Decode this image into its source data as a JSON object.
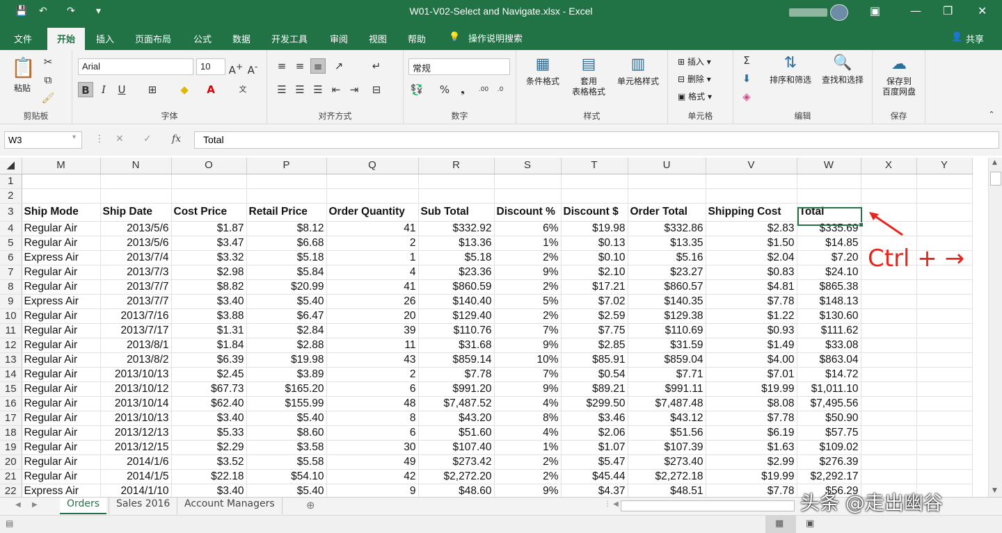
{
  "window": {
    "title": "W01-V02-Select and Navigate.xlsx  -  Excel"
  },
  "qat": {
    "save": "💾",
    "undo": "↶",
    "redo": "↷",
    "more": "▾"
  },
  "ribbon_tabs": [
    {
      "label": "文件"
    },
    {
      "label": "开始"
    },
    {
      "label": "插入"
    },
    {
      "label": "页面布局"
    },
    {
      "label": "公式"
    },
    {
      "label": "数据"
    },
    {
      "label": "开发工具"
    },
    {
      "label": "审阅"
    },
    {
      "label": "视图"
    },
    {
      "label": "帮助"
    }
  ],
  "tell_me": "操作说明搜索",
  "share": "共享",
  "ribbon": {
    "clipboard": {
      "paste": "粘贴",
      "label": "剪贴板"
    },
    "font": {
      "name": "Arial",
      "size": "10",
      "label": "字体",
      "bold": "B",
      "italic": "I",
      "underline": "U"
    },
    "alignment": {
      "label": "对齐方式"
    },
    "number": {
      "format": "常规",
      "label": "数字",
      "percent": "%",
      "comma": "❟"
    },
    "styles": {
      "conditional": "条件格式",
      "table_l1": "套用",
      "table_l2": "表格格式",
      "cell_styles": "单元格样式",
      "label": "样式"
    },
    "cells": {
      "insert": "插入",
      "delete": "删除",
      "format": "格式",
      "label": "单元格"
    },
    "editing": {
      "sort": "排序和筛选",
      "find": "查找和选择",
      "label": "编辑"
    },
    "save": {
      "l1": "保存到",
      "l2": "百度网盘",
      "label": "保存"
    }
  },
  "formula_bar": {
    "name_box": "W3",
    "fx": "fx",
    "value": "Total"
  },
  "columns": [
    "M",
    "N",
    "O",
    "P",
    "Q",
    "R",
    "S",
    "T",
    "U",
    "V",
    "W",
    "X",
    "Y"
  ],
  "headers": [
    "Ship Mode",
    "Ship Date",
    "Cost Price",
    "Retail Price",
    "Order Quantity",
    "Sub Total",
    "Discount %",
    "Discount $",
    "Order Total",
    "Shipping Cost",
    "Total"
  ],
  "rows": [
    {
      "n": "4",
      "c": [
        "Regular Air",
        "2013/5/6",
        "$1.87",
        "$8.12",
        "41",
        "$332.92",
        "6%",
        "$19.98",
        "$332.86",
        "$2.83",
        "$335.69"
      ]
    },
    {
      "n": "5",
      "c": [
        "Regular Air",
        "2013/5/6",
        "$3.47",
        "$6.68",
        "2",
        "$13.36",
        "1%",
        "$0.13",
        "$13.35",
        "$1.50",
        "$14.85"
      ]
    },
    {
      "n": "6",
      "c": [
        "Express Air",
        "2013/7/4",
        "$3.32",
        "$5.18",
        "1",
        "$5.18",
        "2%",
        "$0.10",
        "$5.16",
        "$2.04",
        "$7.20"
      ]
    },
    {
      "n": "7",
      "c": [
        "Regular Air",
        "2013/7/3",
        "$2.98",
        "$5.84",
        "4",
        "$23.36",
        "9%",
        "$2.10",
        "$23.27",
        "$0.83",
        "$24.10"
      ]
    },
    {
      "n": "8",
      "c": [
        "Regular Air",
        "2013/7/7",
        "$8.82",
        "$20.99",
        "41",
        "$860.59",
        "2%",
        "$17.21",
        "$860.57",
        "$4.81",
        "$865.38"
      ]
    },
    {
      "n": "9",
      "c": [
        "Express Air",
        "2013/7/7",
        "$3.40",
        "$5.40",
        "26",
        "$140.40",
        "5%",
        "$7.02",
        "$140.35",
        "$7.78",
        "$148.13"
      ]
    },
    {
      "n": "10",
      "c": [
        "Regular Air",
        "2013/7/16",
        "$3.88",
        "$6.47",
        "20",
        "$129.40",
        "2%",
        "$2.59",
        "$129.38",
        "$1.22",
        "$130.60"
      ]
    },
    {
      "n": "11",
      "c": [
        "Regular Air",
        "2013/7/17",
        "$1.31",
        "$2.84",
        "39",
        "$110.76",
        "7%",
        "$7.75",
        "$110.69",
        "$0.93",
        "$111.62"
      ]
    },
    {
      "n": "12",
      "c": [
        "Regular Air",
        "2013/8/1",
        "$1.84",
        "$2.88",
        "11",
        "$31.68",
        "9%",
        "$2.85",
        "$31.59",
        "$1.49",
        "$33.08"
      ]
    },
    {
      "n": "13",
      "c": [
        "Regular Air",
        "2013/8/2",
        "$6.39",
        "$19.98",
        "43",
        "$859.14",
        "10%",
        "$85.91",
        "$859.04",
        "$4.00",
        "$863.04"
      ]
    },
    {
      "n": "14",
      "c": [
        "Regular Air",
        "2013/10/13",
        "$2.45",
        "$3.89",
        "2",
        "$7.78",
        "7%",
        "$0.54",
        "$7.71",
        "$7.01",
        "$14.72"
      ]
    },
    {
      "n": "15",
      "c": [
        "Regular Air",
        "2013/10/12",
        "$67.73",
        "$165.20",
        "6",
        "$991.20",
        "9%",
        "$89.21",
        "$991.11",
        "$19.99",
        "$1,011.10"
      ]
    },
    {
      "n": "16",
      "c": [
        "Regular Air",
        "2013/10/14",
        "$62.40",
        "$155.99",
        "48",
        "$7,487.52",
        "4%",
        "$299.50",
        "$7,487.48",
        "$8.08",
        "$7,495.56"
      ]
    },
    {
      "n": "17",
      "c": [
        "Regular Air",
        "2013/10/13",
        "$3.40",
        "$5.40",
        "8",
        "$43.20",
        "8%",
        "$3.46",
        "$43.12",
        "$7.78",
        "$50.90"
      ]
    },
    {
      "n": "18",
      "c": [
        "Regular Air",
        "2013/12/13",
        "$5.33",
        "$8.60",
        "6",
        "$51.60",
        "4%",
        "$2.06",
        "$51.56",
        "$6.19",
        "$57.75"
      ]
    },
    {
      "n": "19",
      "c": [
        "Regular Air",
        "2013/12/15",
        "$2.29",
        "$3.58",
        "30",
        "$107.40",
        "1%",
        "$1.07",
        "$107.39",
        "$1.63",
        "$109.02"
      ]
    },
    {
      "n": "20",
      "c": [
        "Regular Air",
        "2014/1/6",
        "$3.52",
        "$5.58",
        "49",
        "$273.42",
        "2%",
        "$5.47",
        "$273.40",
        "$2.99",
        "$276.39"
      ]
    },
    {
      "n": "21",
      "c": [
        "Regular Air",
        "2014/1/5",
        "$22.18",
        "$54.10",
        "42",
        "$2,272.20",
        "2%",
        "$45.44",
        "$2,272.18",
        "$19.99",
        "$2,292.17"
      ]
    },
    {
      "n": "22",
      "c": [
        "Express Air",
        "2014/1/10",
        "$3.40",
        "$5.40",
        "9",
        "$48.60",
        "9%",
        "$4.37",
        "$48.51",
        "$7.78",
        "$56.29"
      ]
    }
  ],
  "sheet_tabs": [
    {
      "label": "Orders"
    },
    {
      "label": "Sales 2016"
    },
    {
      "label": "Account Managers"
    }
  ],
  "annotation": "Ctrl + →",
  "watermark": "头条 @走出幽谷",
  "colors": {
    "excel_green": "#217346",
    "annotation_red": "#e8251c"
  }
}
